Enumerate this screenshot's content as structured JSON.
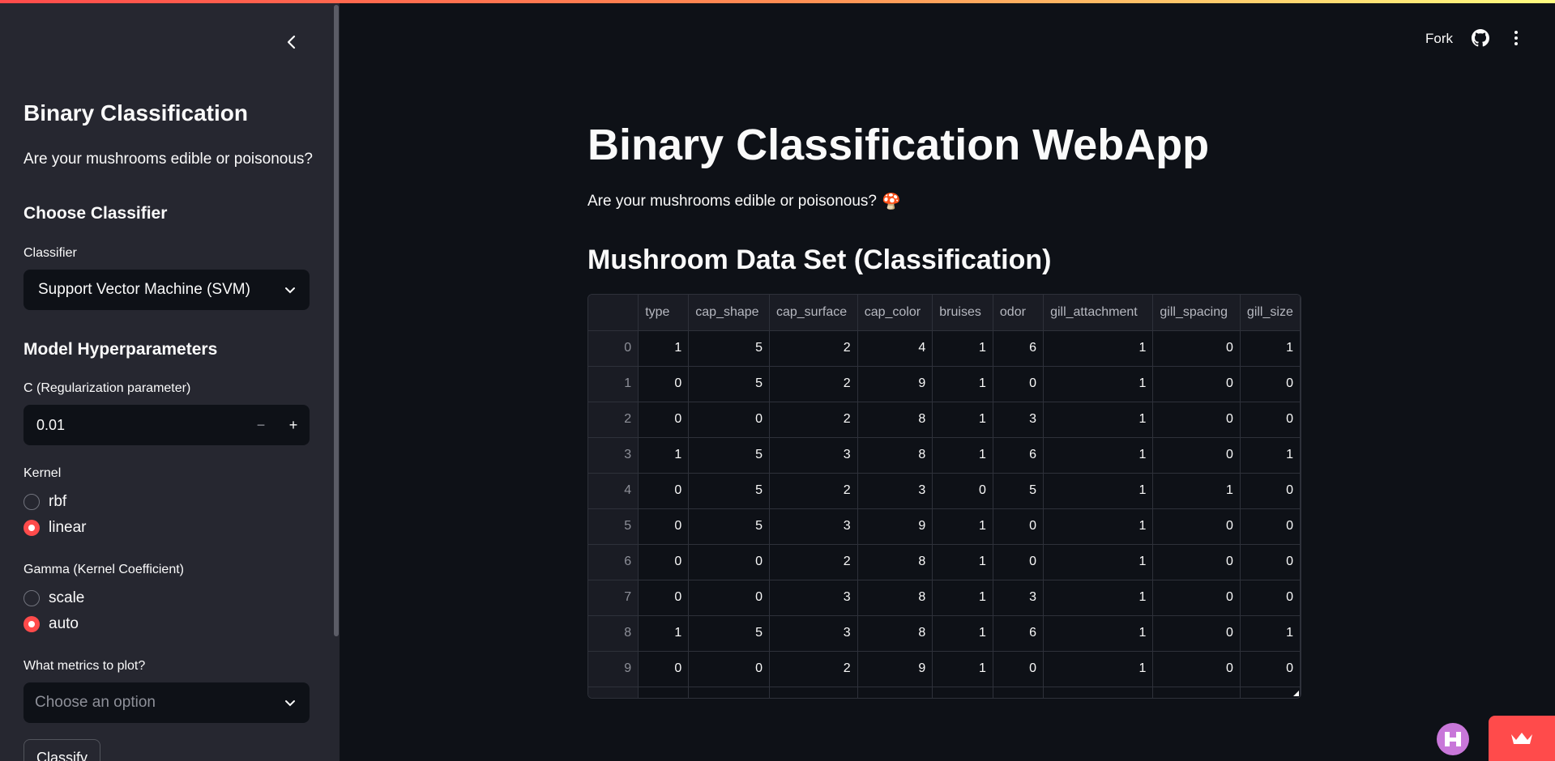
{
  "sidebar": {
    "title": "Binary Classification",
    "subtitle": "Are your mushrooms edible or poisonous?",
    "choose_heading": "Choose Classifier",
    "classifier_label": "Classifier",
    "classifier_value": "Support Vector Machine (SVM)",
    "hyper_heading": "Model Hyperparameters",
    "c_label": "C (Regularization parameter)",
    "c_value": "0.01",
    "kernel_label": "Kernel",
    "kernel_options": [
      "rbf",
      "linear"
    ],
    "kernel_selected": "linear",
    "gamma_label": "Gamma (Kernel Coefficient)",
    "gamma_options": [
      "scale",
      "auto"
    ],
    "gamma_selected": "auto",
    "metrics_label": "What metrics to plot?",
    "metrics_placeholder": "Choose an option",
    "classify_button": "Classify"
  },
  "header": {
    "fork_label": "Fork"
  },
  "main": {
    "title": "Binary Classification WebApp",
    "subtitle": "Are your mushrooms edible or poisonous?",
    "subtitle_emoji": "🍄",
    "section_title": "Mushroom Data Set (Classification)"
  },
  "table": {
    "columns": [
      "",
      "type",
      "cap_shape",
      "cap_surface",
      "cap_color",
      "bruises",
      "odor",
      "gill_attachment",
      "gill_spacing",
      "gill_size"
    ],
    "rows": [
      [
        "0",
        "1",
        "5",
        "2",
        "4",
        "1",
        "6",
        "1",
        "0",
        "1"
      ],
      [
        "1",
        "0",
        "5",
        "2",
        "9",
        "1",
        "0",
        "1",
        "0",
        "0"
      ],
      [
        "2",
        "0",
        "0",
        "2",
        "8",
        "1",
        "3",
        "1",
        "0",
        "0"
      ],
      [
        "3",
        "1",
        "5",
        "3",
        "8",
        "1",
        "6",
        "1",
        "0",
        "1"
      ],
      [
        "4",
        "0",
        "5",
        "2",
        "3",
        "0",
        "5",
        "1",
        "1",
        "0"
      ],
      [
        "5",
        "0",
        "5",
        "3",
        "9",
        "1",
        "0",
        "1",
        "0",
        "0"
      ],
      [
        "6",
        "0",
        "0",
        "2",
        "8",
        "1",
        "0",
        "1",
        "0",
        "0"
      ],
      [
        "7",
        "0",
        "0",
        "3",
        "8",
        "1",
        "3",
        "1",
        "0",
        "0"
      ],
      [
        "8",
        "1",
        "5",
        "3",
        "8",
        "1",
        "6",
        "1",
        "0",
        "1"
      ],
      [
        "9",
        "0",
        "0",
        "2",
        "9",
        "1",
        "0",
        "1",
        "0",
        "0"
      ]
    ]
  },
  "colors": {
    "accent": "#ff4b4b",
    "sidebar_bg": "#262730",
    "main_bg": "#0e1117"
  },
  "icons": [
    "chevron-left-icon",
    "chevron-down-icon",
    "github-icon",
    "kebab-menu-icon",
    "crown-icon",
    "mushroom-emoji"
  ]
}
